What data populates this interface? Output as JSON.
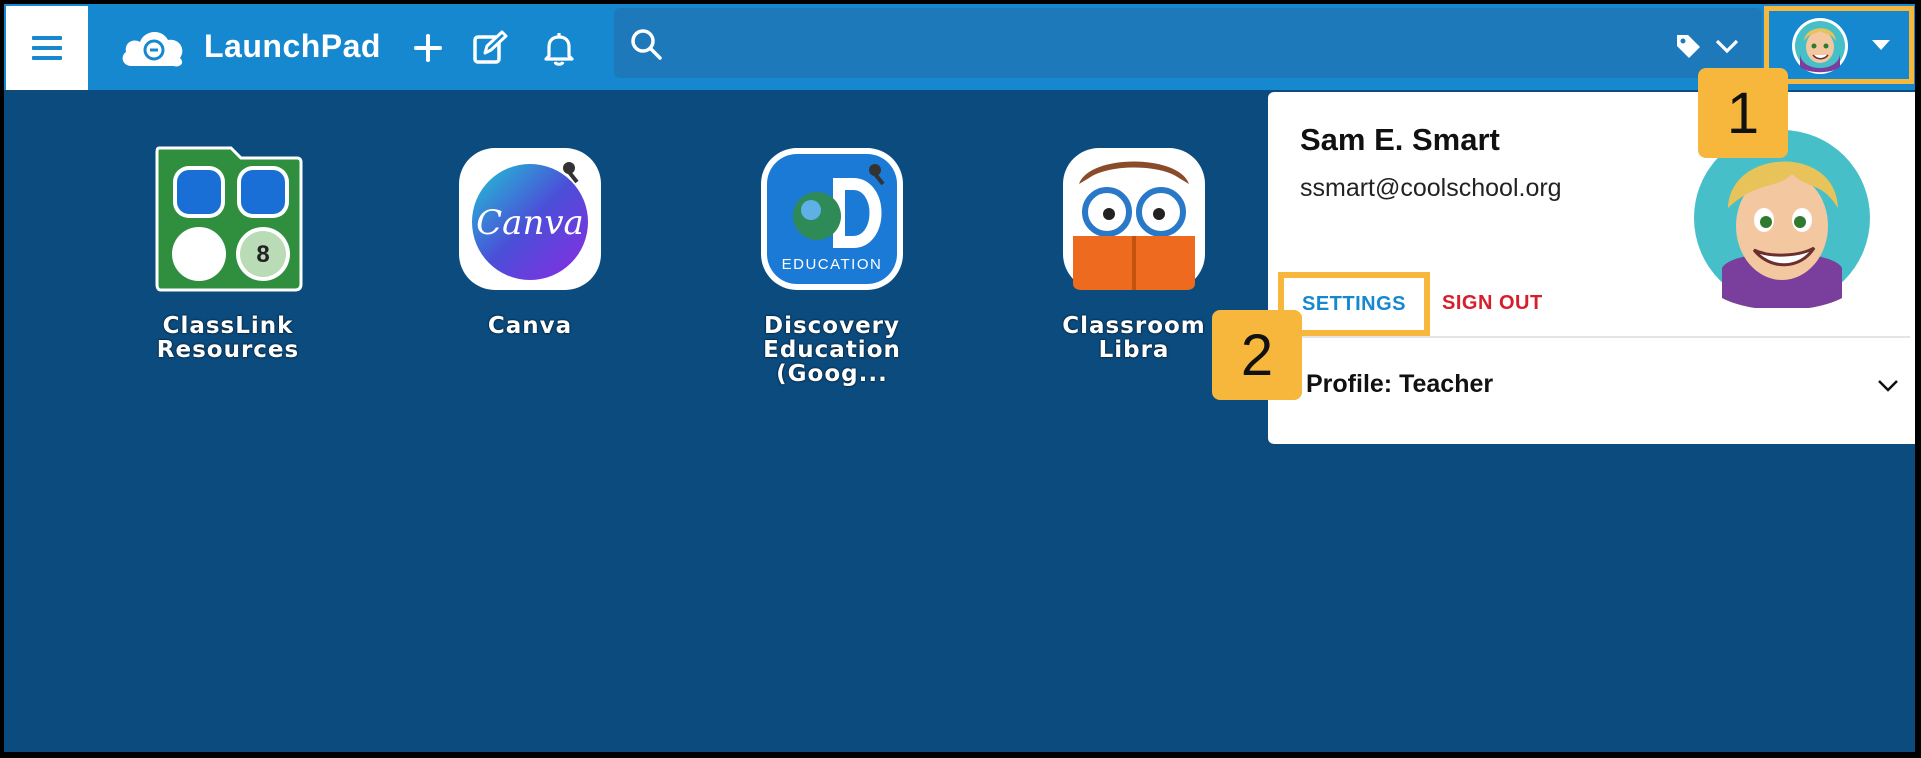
{
  "header": {
    "app_title": "LaunchPad",
    "icons": [
      "menu-icon",
      "classlink-cloud-logo",
      "plus-icon",
      "edit-icon",
      "bell-icon",
      "search-icon",
      "tag-icon",
      "chevron-down-icon",
      "avatar",
      "caret-down-icon"
    ],
    "search": {
      "value": "",
      "placeholder": ""
    }
  },
  "apps": [
    {
      "label_line1": "ClassLink",
      "label_line2": "Resources",
      "icon": "classlink-resources-folder-icon"
    },
    {
      "label_line1": "Canva",
      "label_line2": "",
      "icon": "canva-icon"
    },
    {
      "label_line1": "Discovery",
      "label_line2": "Education (Goog...",
      "icon": "discovery-education-icon"
    },
    {
      "label_line1": "Classroom Libra",
      "label_line2": "",
      "icon": "classroom-library-icon"
    }
  ],
  "profile_menu": {
    "name": "Sam E. Smart",
    "email": "ssmart@coolschool.org",
    "settings_label": "SETTINGS",
    "signout_label": "SIGN OUT",
    "profile_label": "Profile: Teacher"
  },
  "callouts": {
    "first": "1",
    "second": "2"
  },
  "colors": {
    "topbar": "#1688cf",
    "background": "#0b4b7e",
    "highlight": "#f6b73c",
    "settings": "#1688cf",
    "signout": "#d61f2b"
  }
}
